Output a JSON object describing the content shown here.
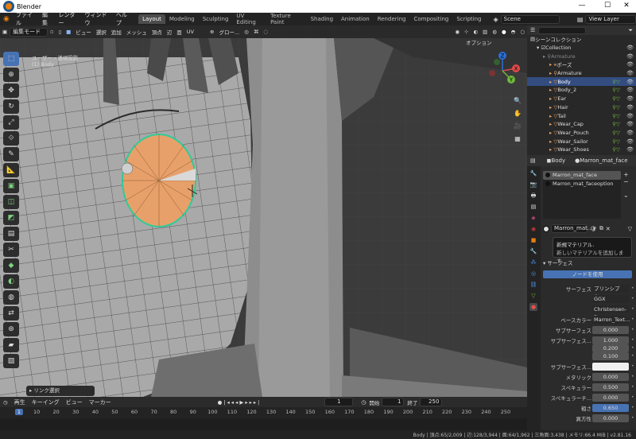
{
  "titlebar": {
    "title": "Blender",
    "minimize": "—",
    "maximize": "☐",
    "close": "✕"
  },
  "topbar": {
    "menus": [
      "ファイル",
      "編集",
      "レンダー",
      "ウィンドウ",
      "ヘルプ"
    ],
    "workspaces": [
      "Layout",
      "Modeling",
      "Sculpting",
      "UV Editing",
      "Texture Paint",
      "Shading",
      "Animation",
      "Rendering",
      "Compositing",
      "Scripting"
    ],
    "active_workspace": "Layout",
    "scene": "Scene",
    "view_layer": "View Layer"
  },
  "viewport": {
    "mode": "編集モード",
    "menus": [
      "ビュー",
      "選択",
      "追加",
      "メッシュ",
      "頂点",
      "辺",
      "面",
      "UV"
    ],
    "transform_orientation": "グロー...",
    "options": "オプション",
    "view_name": "ユーザー・透視投影",
    "object_name": "(1) Body",
    "last_operator": "リンク選択",
    "gizmo": {
      "x": "X",
      "y": "Y",
      "z": "Z"
    }
  },
  "toolbar": {
    "tools": [
      "select-box",
      "cursor",
      "move",
      "rotate",
      "scale",
      "transform",
      "annotate",
      "measure",
      "extrude",
      "inset",
      "bevel",
      "loop-cut",
      "knife",
      "poly-build",
      "spin",
      "smooth",
      "edge-slide",
      "shrink",
      "shear",
      "rip"
    ]
  },
  "outliner": {
    "header": "シーンコレクション",
    "collection": "Collection",
    "items": [
      {
        "name": "Armature",
        "indent": 2,
        "color": "#888",
        "selected": false
      },
      {
        "name": "ポーズ",
        "indent": 3,
        "color": "#ddd",
        "selected": false
      },
      {
        "name": "Armature",
        "indent": 3,
        "color": "#ddd",
        "selected": false
      },
      {
        "name": "Body",
        "indent": 3,
        "color": "#fff",
        "selected": true
      },
      {
        "name": "Body_2",
        "indent": 3,
        "color": "#ddd",
        "selected": false
      },
      {
        "name": "Ear",
        "indent": 3,
        "color": "#ddd",
        "selected": false
      },
      {
        "name": "Hair",
        "indent": 3,
        "color": "#ddd",
        "selected": false
      },
      {
        "name": "Tail",
        "indent": 3,
        "color": "#ddd",
        "selected": false
      },
      {
        "name": "Wear_Cap",
        "indent": 3,
        "color": "#ddd",
        "selected": false
      },
      {
        "name": "Wear_Pouch",
        "indent": 3,
        "color": "#ddd",
        "selected": false
      },
      {
        "name": "Wear_Sailor",
        "indent": 3,
        "color": "#ddd",
        "selected": false
      },
      {
        "name": "Wear_Shoes",
        "indent": 3,
        "color": "#ddd",
        "selected": false
      }
    ]
  },
  "properties": {
    "breadcrumb_object": "Body",
    "breadcrumb_material": "Marron_mat_face",
    "slots": [
      "Marron_mat_face",
      "Marron_mat_faceoption"
    ],
    "material_field": "Marron_mat...",
    "tooltip_title": "新規マテリアル.",
    "tooltip_body": "新しいマテリアルを追加します.",
    "surface_panel": "サーフェス",
    "use_nodes_button": "ノードを使用",
    "rows": [
      {
        "label": "サーフェス",
        "value": "プリンシプル...",
        "style": "plain"
      },
      {
        "label": "",
        "value": "GGX",
        "style": "dark"
      },
      {
        "label": "",
        "value": "Christensen-Bu...",
        "style": "dark"
      },
      {
        "label": "ベースカラー",
        "value": "Marron_Text...",
        "style": "dark"
      },
      {
        "label": "サブサーフェス",
        "value": "0.000",
        "style": "num"
      },
      {
        "label": "サブサーフェス...",
        "value": "1.000",
        "style": "num"
      },
      {
        "label": "",
        "value": "0.200",
        "style": "num"
      },
      {
        "label": "",
        "value": "0.100",
        "style": "num"
      },
      {
        "label": "サブサーフェス...",
        "value": "",
        "style": "white"
      },
      {
        "label": "メタリック",
        "value": "0.000",
        "style": "num"
      },
      {
        "label": "スペキュラー",
        "value": "0.500",
        "style": "num"
      },
      {
        "label": "スペキュラーチ...",
        "value": "0.000",
        "style": "num"
      },
      {
        "label": "粗さ",
        "value": "0.650",
        "style": "blue"
      },
      {
        "label": "異方性",
        "value": "0.000",
        "style": "num"
      }
    ]
  },
  "timeline": {
    "menus": [
      "再生",
      "キーイング",
      "ビュー",
      "マーカー"
    ],
    "current_frame": "1",
    "start_label": "開始",
    "start": "1",
    "end_label": "終了",
    "end": "250",
    "ticks": [
      "1",
      "10",
      "20",
      "30",
      "40",
      "50",
      "60",
      "70",
      "80",
      "90",
      "100",
      "110",
      "120",
      "130",
      "140",
      "150",
      "160",
      "170",
      "180",
      "190",
      "200",
      "210",
      "220",
      "230",
      "240",
      "250"
    ]
  },
  "statusbar": {
    "text": "Body | 頂点:65/2,009 | 辺:128/3,944 | 面:64/1,962 | 三角面:3,438 | メモリ:66.4 MiB | v2.81.16"
  },
  "colors": {
    "accent": "#4772b3",
    "selected_face": "#e8a06a",
    "outliner_selected": "#334d80"
  }
}
